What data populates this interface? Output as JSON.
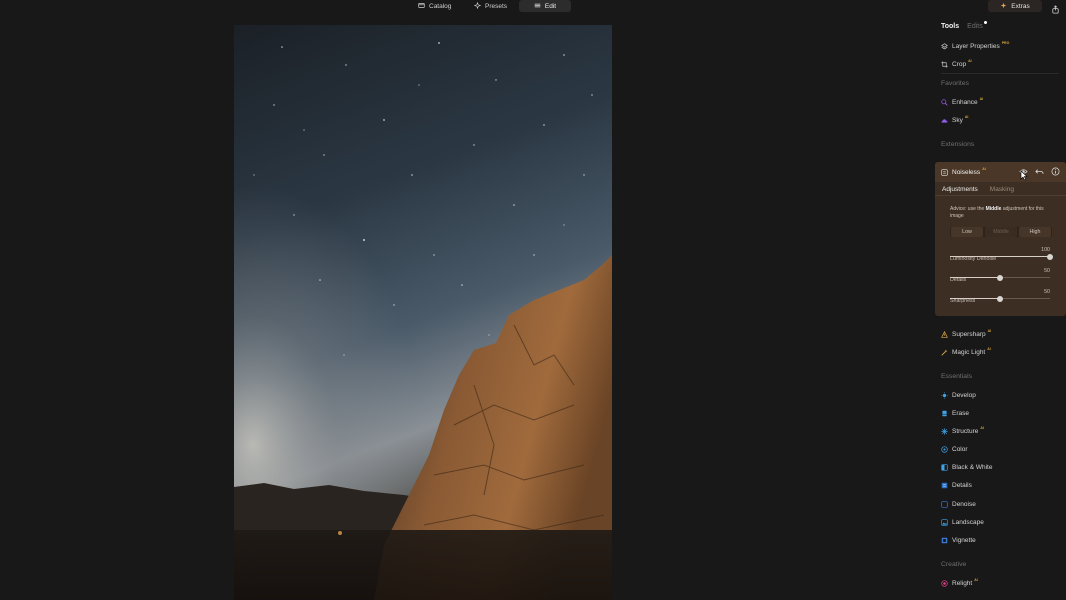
{
  "topbar": {
    "tabs": [
      {
        "label": "Catalog",
        "icon": "catalog-icon"
      },
      {
        "label": "Presets",
        "icon": "presets-icon"
      },
      {
        "label": "Edit",
        "icon": "edit-icon",
        "active": true
      }
    ],
    "extras_label": "Extras"
  },
  "panel": {
    "tabs": {
      "tools": "Tools",
      "edits": "Edits"
    },
    "top_items": [
      {
        "label": "Layer Properties",
        "badge": "PRO"
      },
      {
        "label": "Crop",
        "badge": "AI"
      }
    ],
    "favorites": {
      "title": "Favorites",
      "items": [
        {
          "label": "Enhance",
          "badge": "AI"
        },
        {
          "label": "Sky",
          "badge": "AI"
        }
      ]
    },
    "extensions": {
      "title": "Extensions",
      "noiseless": {
        "title": "Noiseless",
        "badge": "AI",
        "tabs": {
          "adjustments": "Adjustments",
          "masking": "Masking"
        },
        "advice_prefix": "Advice: use the",
        "advice_strong": "Middle",
        "advice_suffix": "adjustment for this image",
        "levels": [
          "Low",
          "Middle",
          "High"
        ],
        "selected_level": "Middle",
        "sliders": [
          {
            "label": "Luminosity Denoise",
            "value": 100
          },
          {
            "label": "Details",
            "value": 50
          },
          {
            "label": "Sharpness",
            "value": 50
          }
        ]
      },
      "items": [
        {
          "label": "Supersharp",
          "badge": "AI"
        },
        {
          "label": "Magic Light",
          "badge": "AI"
        }
      ]
    },
    "essentials": {
      "title": "Essentials",
      "items": [
        {
          "label": "Develop",
          "badge": ""
        },
        {
          "label": "Erase",
          "badge": ""
        },
        {
          "label": "Structure",
          "badge": "AI"
        },
        {
          "label": "Color",
          "badge": ""
        },
        {
          "label": "Black & White",
          "badge": ""
        },
        {
          "label": "Details",
          "badge": ""
        },
        {
          "label": "Denoise",
          "badge": ""
        },
        {
          "label": "Landscape",
          "badge": ""
        },
        {
          "label": "Vignette",
          "badge": ""
        }
      ]
    },
    "creative": {
      "title": "Creative",
      "items": [
        {
          "label": "Relight",
          "badge": "AI"
        }
      ]
    }
  },
  "colors": {
    "background": "#191818",
    "card": "#3c2e22",
    "accent_ai": "#d6a53c"
  }
}
